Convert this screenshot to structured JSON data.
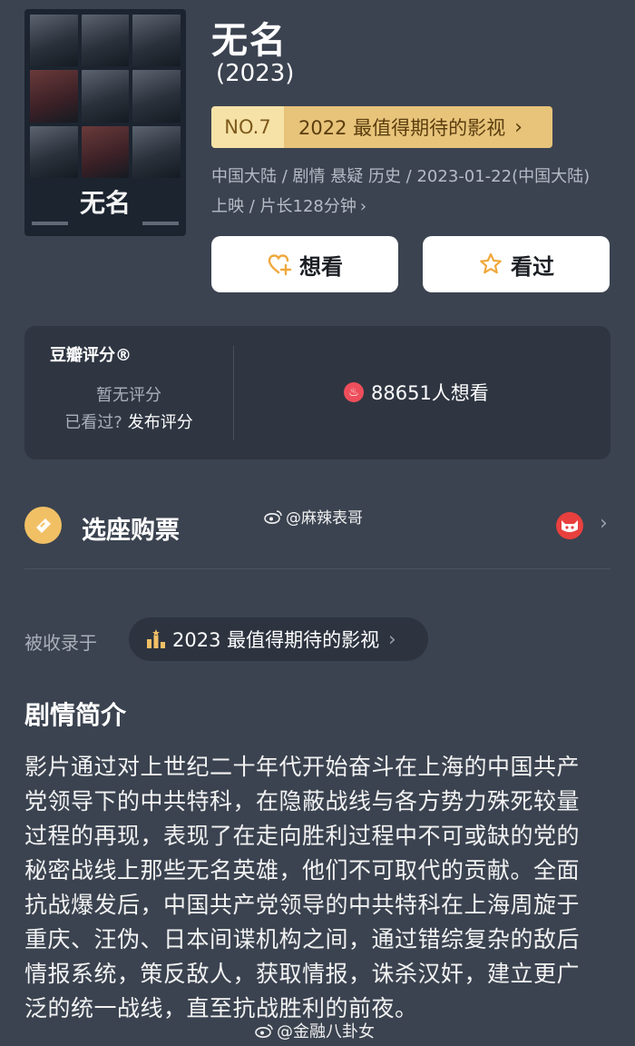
{
  "movie": {
    "title": "无名",
    "year": "(2023)",
    "poster_title": "无名",
    "rank_no": "NO.7",
    "rank_label": "2022 最值得期待的影视",
    "meta_line": "中国大陆 / 剧情 悬疑 历史 / 2023-01-22(中国大陆) 上映 / 片长128分钟"
  },
  "actions": {
    "want_label": "想看",
    "seen_label": "看过"
  },
  "rating": {
    "title": "豆瓣评分®",
    "none_text": "暂无评分",
    "seen_prompt": "已看过?",
    "post_link": "发布评分",
    "want_count_text": "88651人想看"
  },
  "tickets": {
    "label": "选座购票",
    "weibo_tag": "@麻辣表哥"
  },
  "collected": {
    "label": "被收录于",
    "list_name": "2023 最值得期待的影视"
  },
  "synopsis": {
    "title": "剧情简介",
    "text": "影片通过对上世纪二十年代开始奋斗在上海的中国共产党领导下的中共特科，在隐蔽战线与各方势力殊死较量过程的再现，表现了在走向胜利过程中不可或缺的党的秘密战线上那些无名英雄，他们不可取代的贡献。全面抗战爆发后，中国共产党领导的中共特科在上海周旋于重庆、汪伪、日本间谍机构之间，通过错综复杂的敌后情报系统，策反敌人，获取情报，诛杀汉奸，建立更广泛的统一战线，直至抗战胜利的前夜。"
  },
  "watermark": "@金融八卦女",
  "colors": {
    "background": "#3b4350",
    "card": "#2f3642",
    "rank_light": "#f6e2a6",
    "rank_gold": "#e7c47a",
    "fire_red": "#ee4e5b",
    "ticket_yellow": "#f1c065"
  },
  "icons": [
    "heart-plus-icon",
    "star-icon",
    "fire-icon",
    "ticket-icon",
    "weibo-icon",
    "maoyan-icon",
    "chevron-right-icon",
    "trophy-icon"
  ]
}
